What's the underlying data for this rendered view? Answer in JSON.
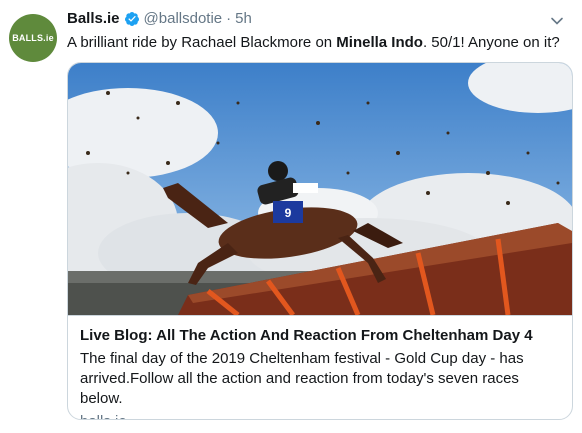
{
  "avatar": {
    "text": "BALLS.ie",
    "color": "#5f8a3c"
  },
  "tweet": {
    "display_name": "Balls.ie",
    "handle": "@ballsdotie",
    "separator": "·",
    "time": "5h",
    "text_part1": "A brilliant ride by Rachael Blackmore on ",
    "text_bold": "Minella Indo",
    "text_part2": ". 50/1! Anyone on it?"
  },
  "card": {
    "image_icon": "horse-racing-photo",
    "title": "Live Blog: All The Action And Reaction From Cheltenham Day 4",
    "description": "The final day of the 2019 Cheltenham festival - Gold Cup day - has arrived.Follow all the action and reaction from today's seven races below.",
    "domain": "balls.ie",
    "saddle_number": "9"
  },
  "colors": {
    "verified": "#1da1f2",
    "secondary_text": "#657786",
    "border": "#ccd6dd"
  }
}
